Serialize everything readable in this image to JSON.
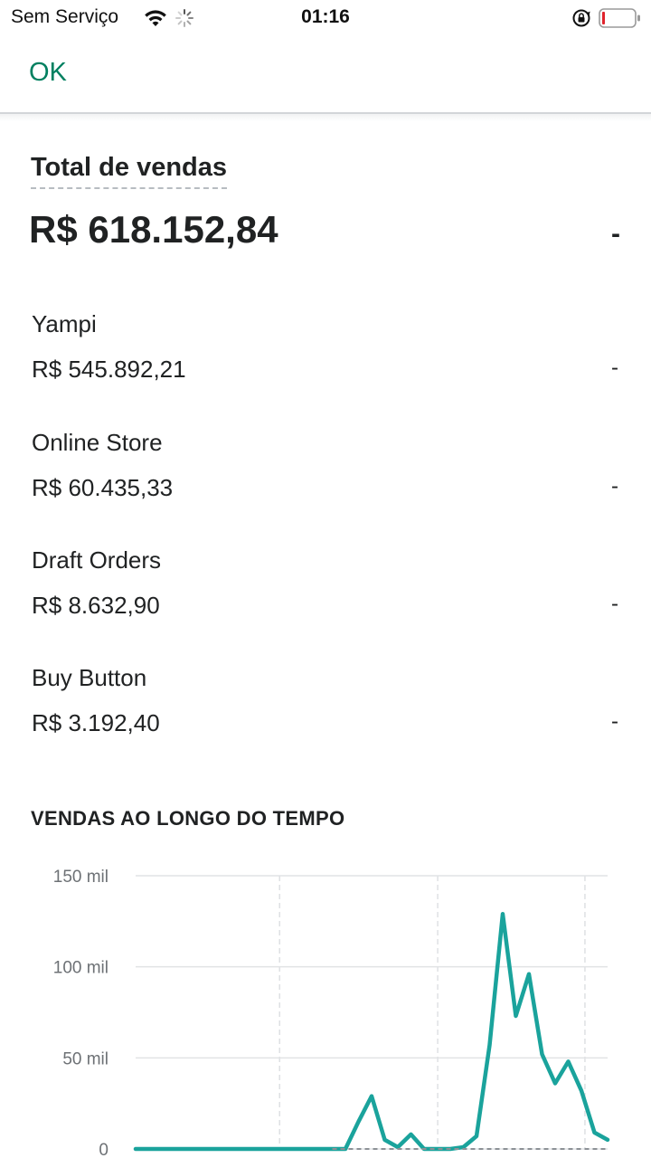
{
  "status_bar": {
    "carrier": "Sem Serviço",
    "time": "01:16",
    "icons": [
      "wifi-icon",
      "loading-spinner-icon",
      "orientation-lock-icon",
      "battery-low-icon"
    ]
  },
  "header": {
    "ok_label": "OK",
    "accent_color": "#008060"
  },
  "summary": {
    "title": "Total de vendas",
    "total": "R$ 618.152,84",
    "total_delta": "-",
    "channels": [
      {
        "name": "Yampi",
        "value": "R$ 545.892,21",
        "delta": "-"
      },
      {
        "name": "Online Store",
        "value": "R$ 60.435,33",
        "delta": "-"
      },
      {
        "name": "Draft Orders",
        "value": "R$ 8.632,90",
        "delta": "-"
      },
      {
        "name": "Buy Button",
        "value": "R$ 3.192,40",
        "delta": "-"
      }
    ]
  },
  "sales_over_time": {
    "heading": "VENDAS AO LONGO DO TEMPO",
    "chart_data": {
      "type": "line",
      "yticks": [
        "150 mil",
        "100 mil",
        "50 mil",
        "0"
      ],
      "ytick_values": [
        150000,
        100000,
        50000,
        0
      ],
      "ylim": [
        0,
        150000
      ],
      "xlim": [
        0,
        36
      ],
      "grid": true,
      "series": [
        {
          "color": "#1aa39c",
          "x": [
            0,
            1,
            2,
            3,
            4,
            5,
            6,
            7,
            8,
            9,
            10,
            11,
            12,
            13,
            14,
            15,
            16,
            17,
            18,
            19,
            20,
            21,
            22,
            23,
            24,
            25,
            26,
            27,
            28,
            29,
            30,
            31,
            32,
            33,
            34,
            35,
            36
          ],
          "values": [
            0,
            0,
            0,
            0,
            0,
            0,
            0,
            0,
            0,
            0,
            0,
            0,
            0,
            0,
            0,
            0,
            0,
            15000,
            29000,
            5000,
            1000,
            8000,
            0,
            0,
            0,
            1000,
            7000,
            57000,
            129000,
            73000,
            96000,
            52000,
            36000,
            48000,
            32000,
            9000,
            5000
          ]
        },
        {
          "color": "#8c9196",
          "dashed": true,
          "x": [
            15,
            36
          ],
          "values": [
            0,
            0
          ]
        }
      ]
    }
  }
}
